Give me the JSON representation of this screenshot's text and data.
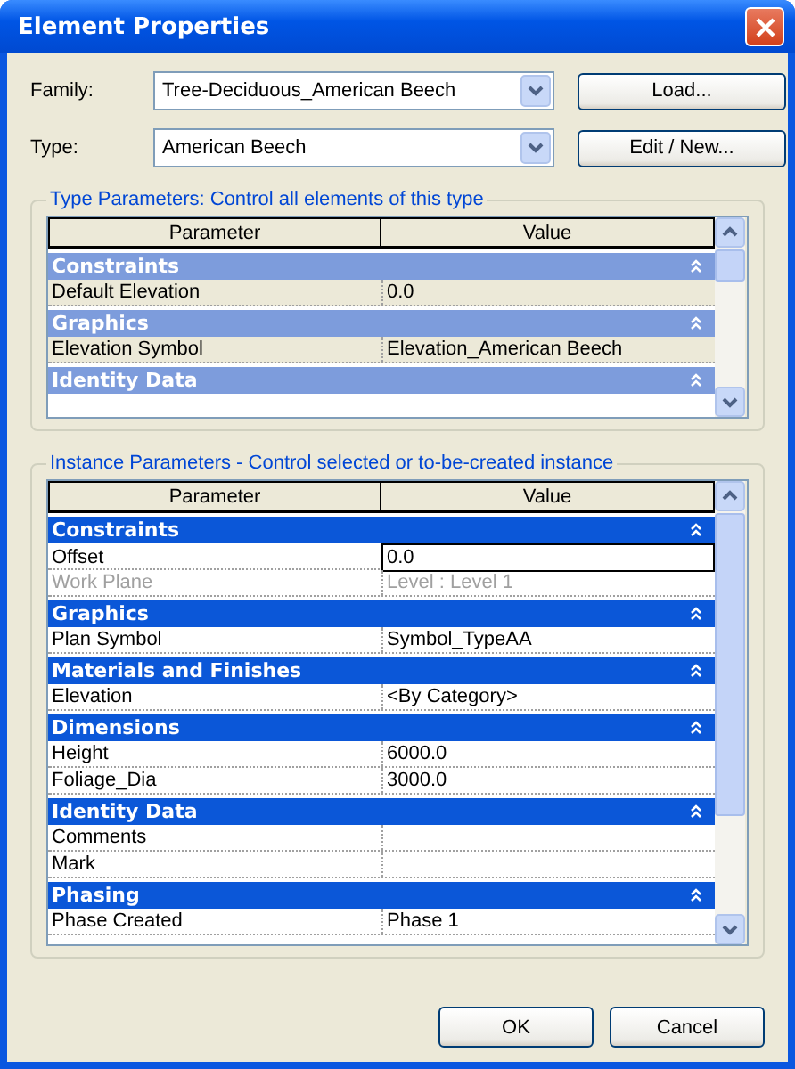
{
  "window": {
    "title": "Element Properties"
  },
  "fields": [
    {
      "label": "Family:",
      "value": "Tree-Deciduous_American Beech",
      "button": "Load..."
    },
    {
      "label": "Type:",
      "value": "American Beech",
      "button": "Edit / New..."
    }
  ],
  "type_parameters": {
    "title": "Type Parameters: Control all elements of this type",
    "active": false,
    "columns": [
      "Parameter",
      "Value"
    ],
    "groups": [
      {
        "name": "Constraints",
        "expanded": true,
        "rows": [
          {
            "parameter": "Default Elevation",
            "value": "0.0",
            "disabled": false,
            "editing": false
          }
        ]
      },
      {
        "name": "Graphics",
        "expanded": true,
        "rows": [
          {
            "parameter": "Elevation Symbol",
            "value": "Elevation_American Beech",
            "disabled": false,
            "editing": false
          }
        ]
      },
      {
        "name": "Identity Data",
        "expanded": true
      }
    ]
  },
  "instance_parameters": {
    "title": "Instance Parameters - Control selected or to-be-created instance",
    "active": true,
    "columns": [
      "Parameter",
      "Value"
    ],
    "groups": [
      {
        "name": "Constraints",
        "expanded": true,
        "rows": [
          {
            "parameter": "Offset",
            "value": "0.0",
            "disabled": false,
            "editing": true
          },
          {
            "parameter": "Work Plane",
            "value": "Level : Level 1",
            "disabled": true,
            "editing": false
          }
        ]
      },
      {
        "name": "Graphics",
        "expanded": true,
        "rows": [
          {
            "parameter": "Plan Symbol",
            "value": "Symbol_TypeAA",
            "disabled": false,
            "editing": false
          }
        ]
      },
      {
        "name": "Materials and Finishes",
        "expanded": true,
        "rows": [
          {
            "parameter": "Elevation",
            "value": "<By Category>",
            "disabled": false,
            "editing": false
          }
        ]
      },
      {
        "name": "Dimensions",
        "expanded": true,
        "rows": [
          {
            "parameter": "Height",
            "value": "6000.0",
            "disabled": false,
            "editing": false
          },
          {
            "parameter": "Foliage_Dia",
            "value": "3000.0",
            "disabled": false,
            "editing": false
          }
        ]
      },
      {
        "name": "Identity Data",
        "expanded": true,
        "rows": [
          {
            "parameter": "Comments",
            "disabled": false,
            "editing": false
          },
          {
            "parameter": "Mark",
            "disabled": false,
            "editing": false
          }
        ]
      },
      {
        "name": "Phasing",
        "expanded": true,
        "rows": [
          {
            "parameter": "Phase Created",
            "value": "Phase 1",
            "disabled": false,
            "editing": false
          }
        ]
      }
    ]
  },
  "buttons": [
    "OK",
    "Cancel"
  ]
}
